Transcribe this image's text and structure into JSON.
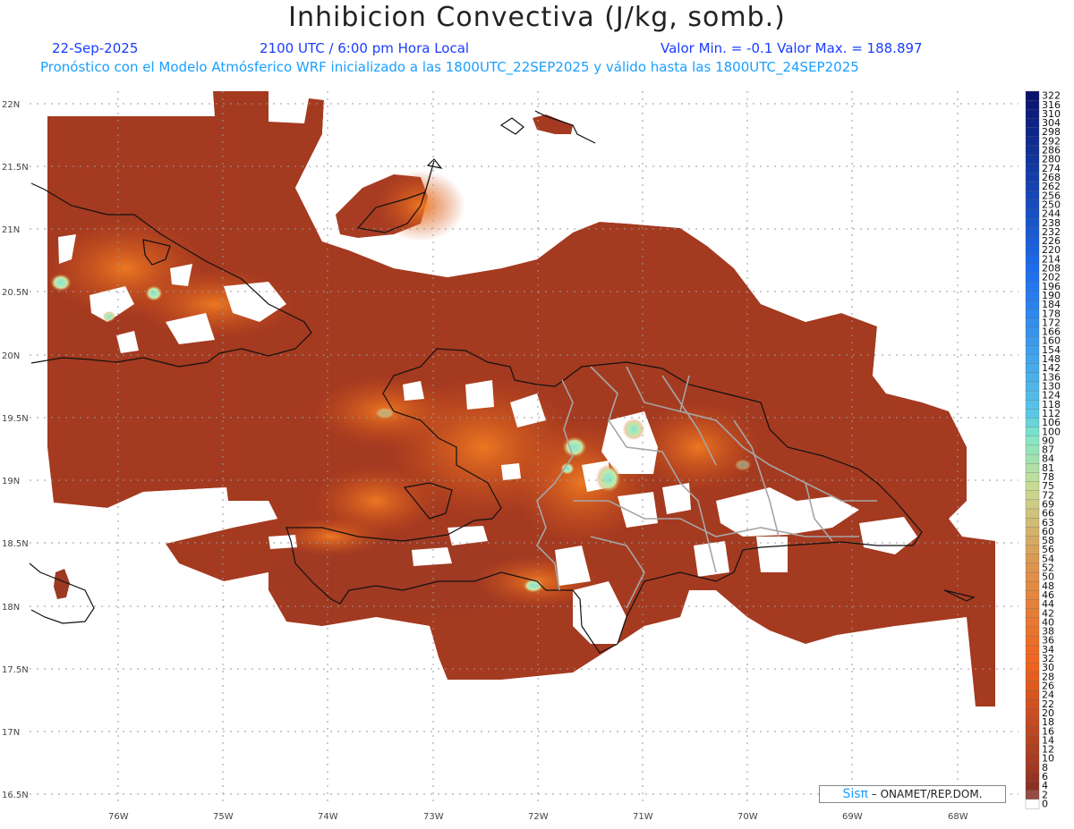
{
  "header": {
    "title": "Inhibicion Convectiva (J/kg, somb.)",
    "date": "22-Sep-2025",
    "time": "2100 UTC / 6:00 pm Hora Local",
    "minmax": "Valor Min. = -0.1  Valor Max. = 188.897",
    "forecast": "Pronóstico con el Modelo Atmósferico WRF inicializado a las 1800UTC_22SEP2025 y válido hasta las  1800UTC_24SEP2025"
  },
  "lat_labels": [
    "22N",
    "21.5N",
    "21N",
    "20.5N",
    "20N",
    "19.5N",
    "19N",
    "18.5N",
    "18N",
    "17.5N",
    "17N",
    "16.5N"
  ],
  "lon_labels": [
    "76W",
    "75W",
    "74W",
    "73W",
    "72W",
    "71W",
    "70W",
    "69W",
    "68W"
  ],
  "colorbar": {
    "labels": [
      "322",
      "316",
      "310",
      "304",
      "298",
      "292",
      "286",
      "280",
      "274",
      "268",
      "262",
      "256",
      "250",
      "244",
      "238",
      "232",
      "226",
      "220",
      "214",
      "208",
      "202",
      "196",
      "190",
      "184",
      "178",
      "172",
      "166",
      "160",
      "154",
      "148",
      "142",
      "136",
      "130",
      "124",
      "118",
      "112",
      "106",
      "100",
      "90",
      "87",
      "84",
      "81",
      "78",
      "75",
      "72",
      "69",
      "66",
      "63",
      "60",
      "58",
      "56",
      "54",
      "52",
      "50",
      "48",
      "46",
      "44",
      "42",
      "40",
      "38",
      "36",
      "34",
      "32",
      "30",
      "28",
      "26",
      "24",
      "22",
      "20",
      "18",
      "16",
      "14",
      "12",
      "10",
      "8",
      "6",
      "4",
      "2",
      "0"
    ]
  },
  "credit": {
    "logo": "Sisπ",
    "text": " – ONAMET/REP.DOM."
  },
  "colors": {
    "field_base": "#8c3424",
    "field_mid": "#b8401c",
    "field_hot": "#e8641a",
    "high_cyan": "#7fe6d2",
    "coast": "#111111",
    "provinces": "#a0a0a0"
  }
}
